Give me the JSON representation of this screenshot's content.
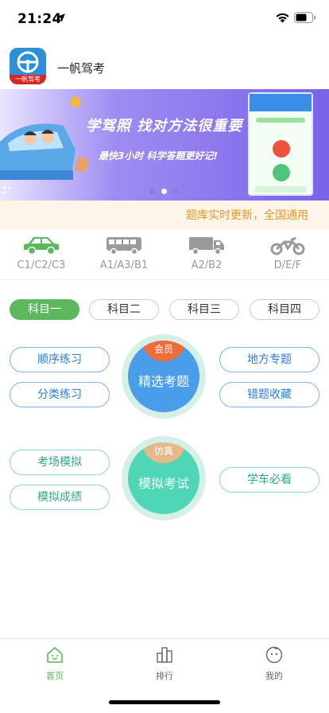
{
  "status_bar": {
    "time": "21:24"
  },
  "app": {
    "name": "一帆驾考",
    "logo_text": "一帆驾考"
  },
  "banner": {
    "headline": "学驾照 找对方法很重要",
    "subline": "最快3小时  科学答题更好记!",
    "dot_count": 3,
    "active_dot": 1
  },
  "notice": {
    "text": "题库实时更新，全国通用"
  },
  "license_types": [
    {
      "label": "C1/C2/C3",
      "icon": "car-icon",
      "active": true
    },
    {
      "label": "A1/A3/B1",
      "icon": "bus-icon",
      "active": false
    },
    {
      "label": "A2/B2",
      "icon": "truck-icon",
      "active": false
    },
    {
      "label": "D/E/F",
      "icon": "motorcycle-icon",
      "active": false
    }
  ],
  "subjects": {
    "tabs": [
      "科目一",
      "科目二",
      "科目三",
      "科目四"
    ],
    "active_index": 0
  },
  "practice": {
    "left": [
      "顺序练习",
      "分类练习"
    ],
    "right": [
      "地方专题",
      "错题收藏"
    ],
    "center": {
      "title": "精选考题",
      "badge": "会员"
    }
  },
  "exam": {
    "left": [
      "考场模拟",
      "模拟成绩"
    ],
    "right": [
      "学车必看"
    ],
    "center": {
      "title": "模拟考试",
      "badge": "仿真"
    }
  },
  "tab_bar": {
    "items": [
      {
        "label": "首页",
        "icon": "home-icon"
      },
      {
        "label": "排行",
        "icon": "ranking-icon"
      },
      {
        "label": "我的",
        "icon": "profile-icon"
      }
    ],
    "active_index": 0
  },
  "colors": {
    "accent_green": "#5cb85c",
    "banner_purple": "#7a62ea",
    "notice_orange": "#e8952a",
    "practice_blue": "#4a9de8",
    "exam_teal": "#4fd6b6",
    "badge_orange": "#f26b3a",
    "badge_tan": "#e6b98a"
  }
}
